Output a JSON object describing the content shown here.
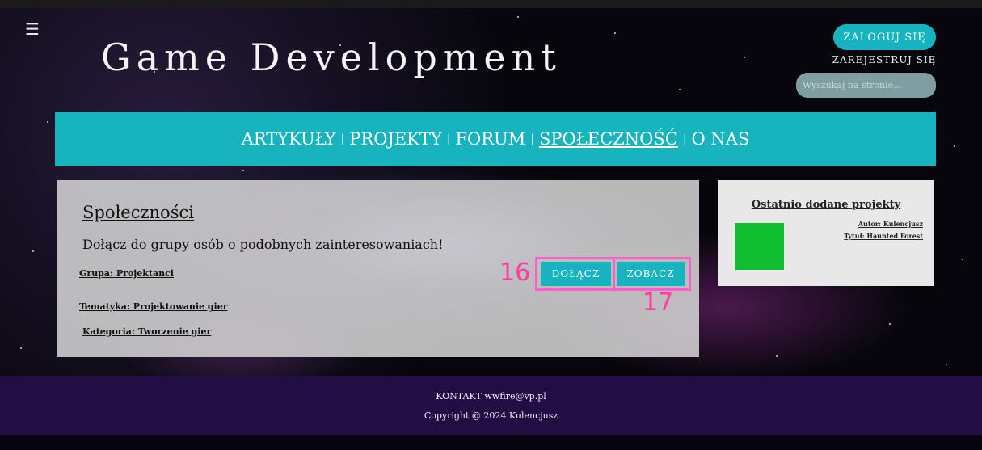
{
  "header": {
    "menu_icon": "☰",
    "site_title": "Game Development",
    "login_label": "ZALOGUJ SIĘ",
    "register_label": "ZAREJESTRUJ SIĘ",
    "search_placeholder": "Wyszukaj na stronie..."
  },
  "nav": {
    "items": [
      {
        "label": "ARTYKUŁY"
      },
      {
        "label": "PROJEKTY"
      },
      {
        "label": "FORUM"
      },
      {
        "label": "SPOŁECZNOŚĆ"
      },
      {
        "label": "O NAS"
      }
    ],
    "separator": "|",
    "active_index": 3
  },
  "main": {
    "title": "Społeczności",
    "description": "Dołącz do grupy osób o podobnych zainteresowaniach!",
    "group": "Grupa: Projektanci",
    "topic": "Tematyka: Projektowanie gier",
    "category": "Kategoria: Tworzenie gier",
    "join_label": "DOŁĄCZ",
    "view_label": "ZOBACZ"
  },
  "annotations": {
    "join_number": "16",
    "view_number": "17",
    "color": "#ff3ba0"
  },
  "sidebar": {
    "title": "Ostatnio dodane projekty",
    "author": "Autor: Kulencjusz",
    "project_title": "Tytuł: Haunted Forest",
    "thumb_color": "#0fbf30"
  },
  "footer": {
    "contact": "KONTAKT wwfire@vp.pl",
    "copyright": "Copyright @ 2024 Kulencjusz"
  },
  "colors": {
    "accent": "#17b3be",
    "footer_bg": "#220d44"
  }
}
